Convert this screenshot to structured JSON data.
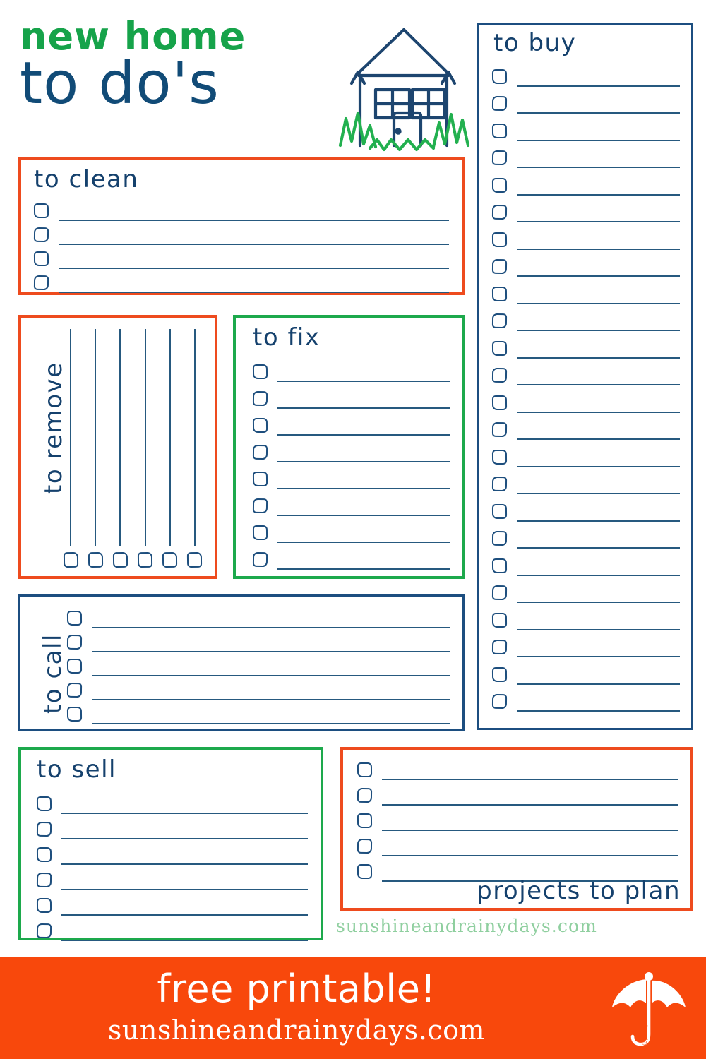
{
  "document": {
    "title_line1": "new home",
    "title_line2": "to do's",
    "colors": {
      "orange": "#ee4b1e",
      "green": "#1da94c",
      "navy": "#1c4e80",
      "title_green": "#16a34a",
      "title_navy": "#114b77",
      "banner_orange": "#f8480c",
      "line_navy": "#26597f",
      "url_green": "#8fcf9f"
    }
  },
  "illustration": {
    "house_icon": "house-doodle-icon",
    "grass_icon": "grass-doodle-icon"
  },
  "sections": {
    "to_clean": {
      "label": "to clean",
      "rows": 4,
      "border": "orange"
    },
    "to_remove": {
      "label": "to remove",
      "columns": 6,
      "border": "orange",
      "orientation": "vertical"
    },
    "to_fix": {
      "label": "to fix",
      "rows": 8,
      "border": "green"
    },
    "to_buy": {
      "label": "to buy",
      "rows": 24,
      "border": "navy"
    },
    "to_call": {
      "label": "to call",
      "rows": 5,
      "border": "navy",
      "orientation": "vertical-label"
    },
    "to_sell": {
      "label": "to sell",
      "rows": 6,
      "border": "green"
    },
    "projects_to_plan": {
      "label": "projects to plan",
      "rows": 5,
      "border": "orange",
      "label_position": "bottom-right"
    }
  },
  "site_url": "sunshineandrainydays.com",
  "footer": {
    "headline": "free printable!",
    "url": "sunshineandrainydays.com",
    "logo_icon": "umbrella-icon"
  }
}
